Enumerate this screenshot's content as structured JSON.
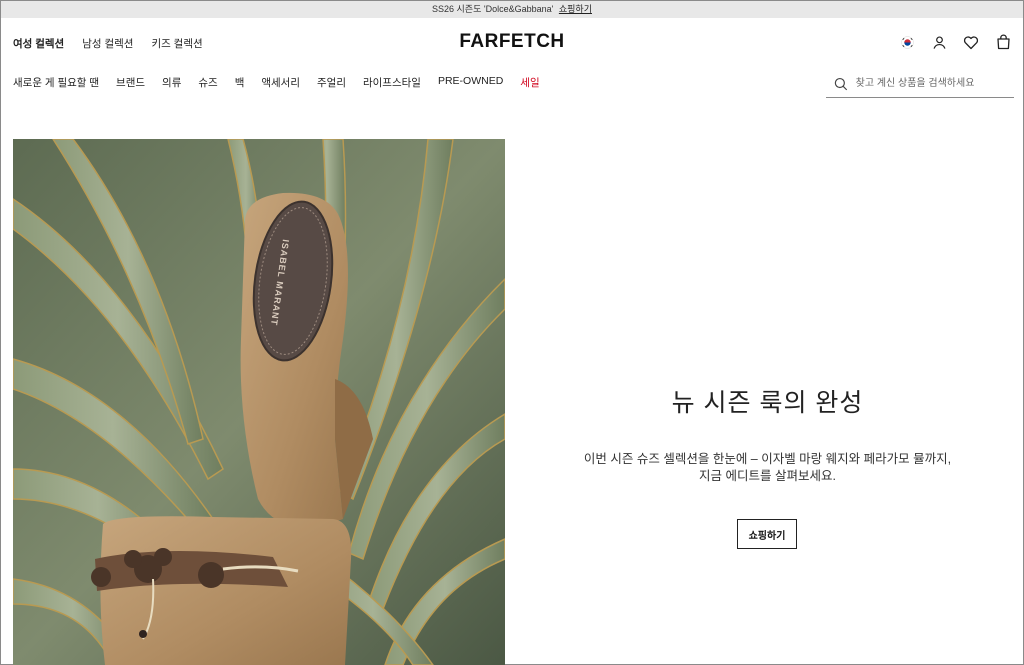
{
  "promo": {
    "text": "SS26 시즌도 'Dolce&Gabbana'",
    "link": "쇼핑하기"
  },
  "gender_tabs": [
    "여성 컬렉션",
    "남성 컬렉션",
    "키즈 컬렉션"
  ],
  "active_gender": "여성 컬렉션",
  "logo": "FARFETCH",
  "header_icons": [
    "flag-kr-icon",
    "account-icon",
    "wishlist-heart-icon",
    "bag-icon"
  ],
  "nav": [
    "새로운 게 필요할 땐",
    "브랜드",
    "의류",
    "슈즈",
    "백",
    "액세서리",
    "주얼리",
    "라이프스타일",
    "PRE-OWNED",
    "세일"
  ],
  "sale_color": "#d0021b",
  "search": {
    "placeholder": "찾고 계신 상품을 검색하세요"
  },
  "hero": {
    "title": "뉴 시즌 룩의 완성",
    "desc_line1": "이번 시즌 슈즈 셀렉션을 한눈에 – 이자벨 마랑 웨지와 페라가모 뮬까지,",
    "desc_line2": "지금 에디트를 살펴보세요.",
    "button": "쇼핑하기",
    "image_alt": "ISABEL MARANT"
  }
}
